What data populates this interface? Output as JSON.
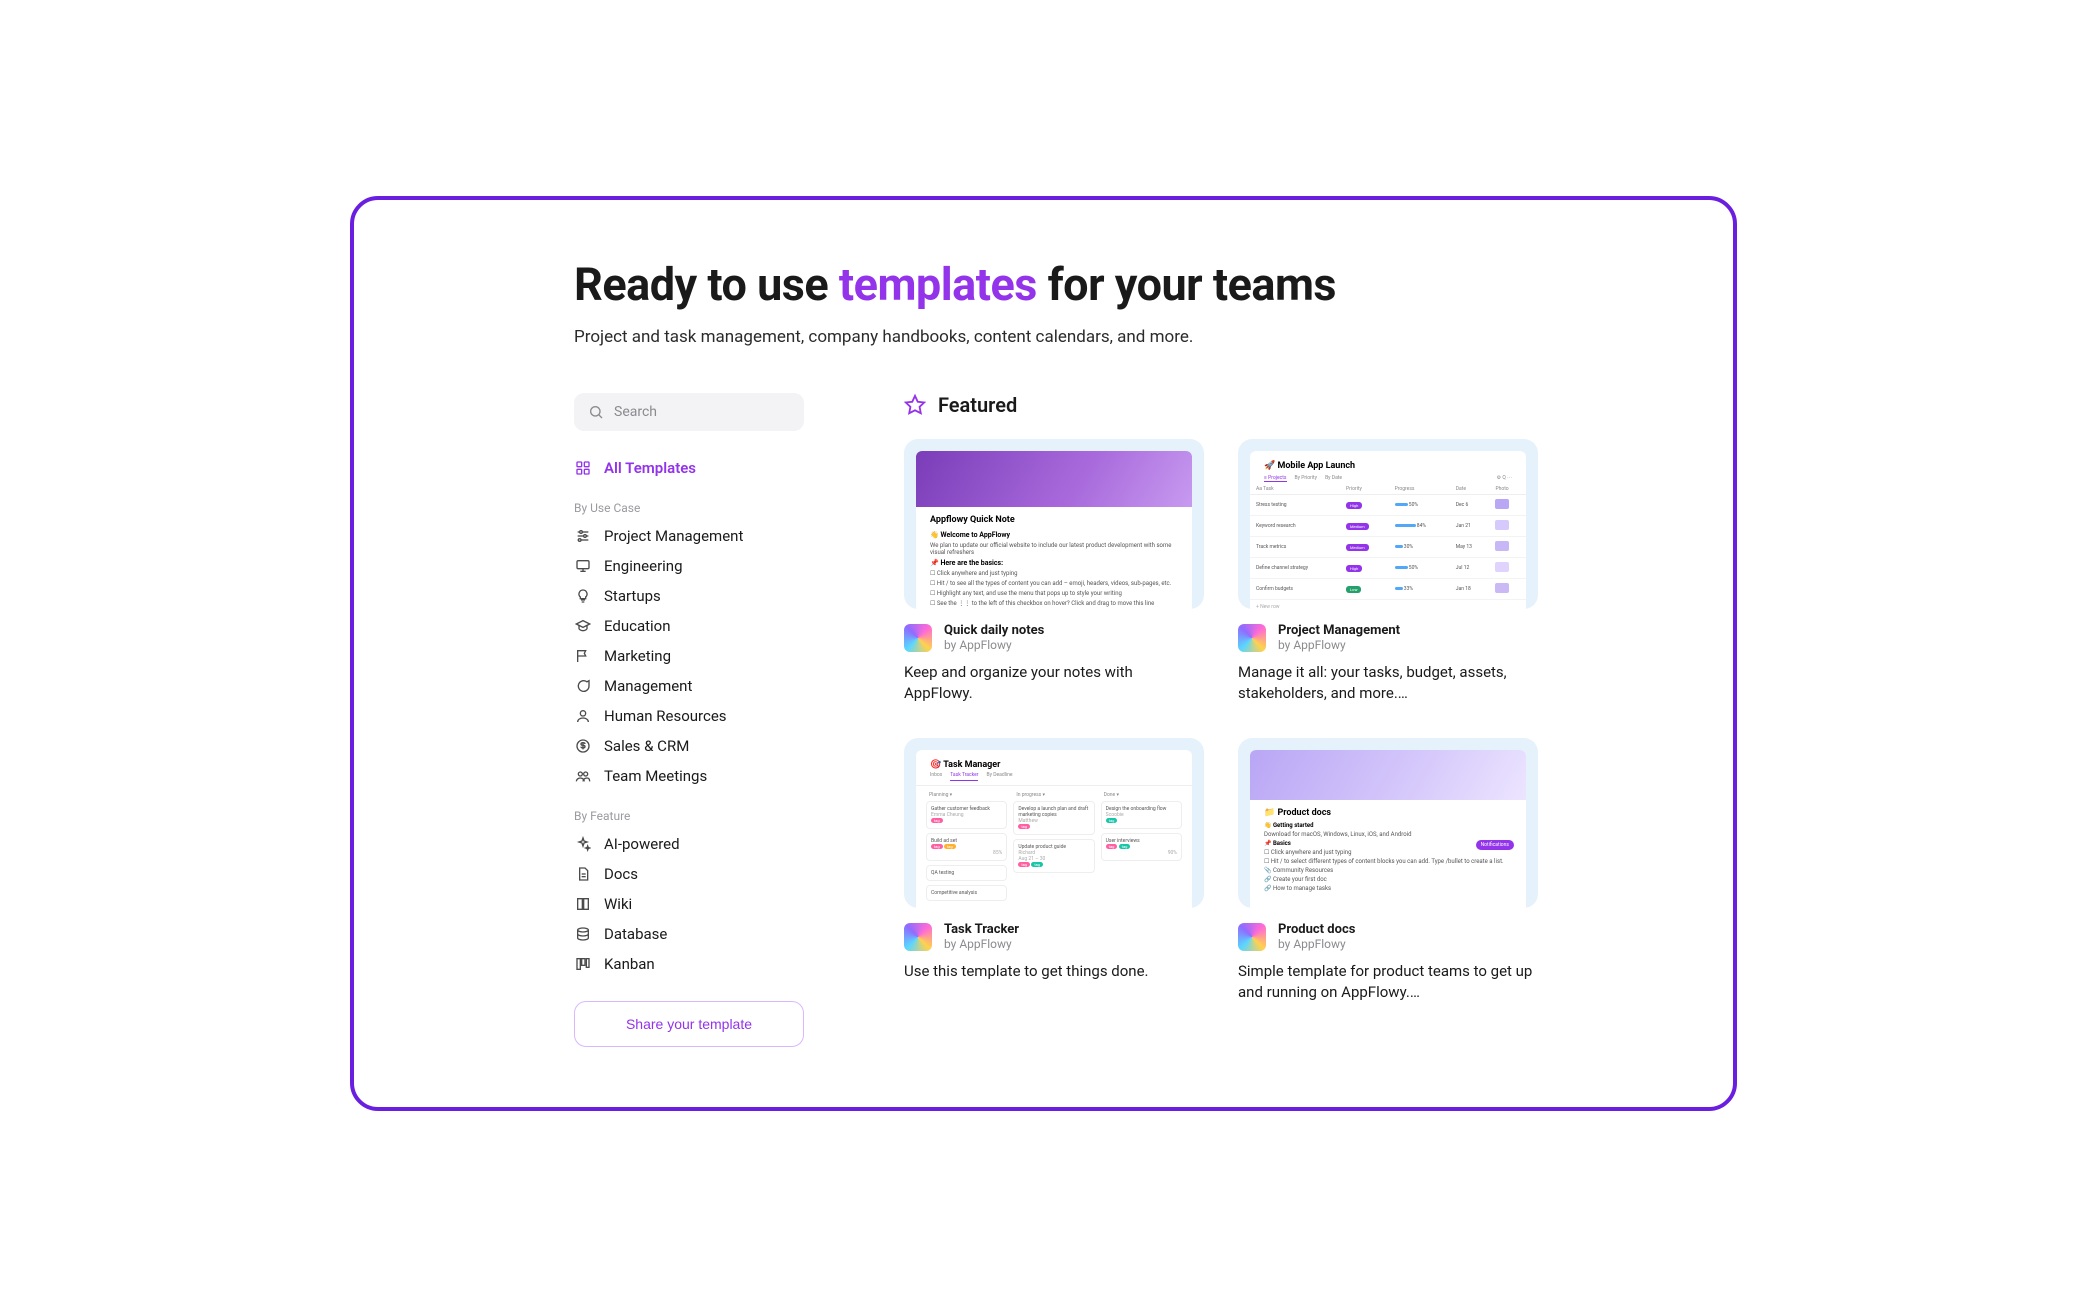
{
  "hero": {
    "title_pre": "Ready to use ",
    "title_accent": "templates",
    "title_post": " for your teams",
    "subtitle": "Project and task management, company handbooks, content calendars, and more."
  },
  "search": {
    "placeholder": "Search"
  },
  "sidebar": {
    "all_label": "All Templates",
    "section1_header": "By Use Case",
    "section1": [
      {
        "label": "Project Management",
        "icon": "sliders"
      },
      {
        "label": "Engineering",
        "icon": "monitor"
      },
      {
        "label": "Startups",
        "icon": "bulb"
      },
      {
        "label": "Education",
        "icon": "grad"
      },
      {
        "label": "Marketing",
        "icon": "flag"
      },
      {
        "label": "Management",
        "icon": "chat"
      },
      {
        "label": "Human Resources",
        "icon": "user"
      },
      {
        "label": "Sales & CRM",
        "icon": "dollar"
      },
      {
        "label": "Team Meetings",
        "icon": "team"
      }
    ],
    "section2_header": "By Feature",
    "section2": [
      {
        "label": "AI-powered",
        "icon": "sparkle"
      },
      {
        "label": "Docs",
        "icon": "doc"
      },
      {
        "label": "Wiki",
        "icon": "book"
      },
      {
        "label": "Database",
        "icon": "db"
      },
      {
        "label": "Kanban",
        "icon": "kanban"
      }
    ],
    "share_button": "Share your template"
  },
  "featured": {
    "heading": "Featured",
    "cards": [
      {
        "title": "Quick daily notes",
        "author": "by AppFlowy",
        "description": "Keep and organize your notes with AppFlowy.",
        "thumb_title": "Appflowy Quick Note",
        "thumb_lines": [
          "👋 Welcome to AppFlowy",
          "We plan to update our official website to include our latest product development with some visual refreshers",
          "📌 Here are the basics:",
          "☐ Click anywhere and just typing",
          "☐ Hit  /  to see all the types of content you can add – emoji, headers, videos, sub-pages, etc.",
          "☐ Highlight any text, and use the menu that pops up to style your writing",
          "☐ See the ⋮⋮ to the left of this checkbox on hover? Click and drag to move this line"
        ]
      },
      {
        "title": "Project Management",
        "author": "by AppFlowy",
        "description": "Manage it all: your tasks, budget, assets, stakeholders, and more.…",
        "thumb_title": "🚀 Mobile App Launch",
        "table": {
          "headers": [
            "Task",
            "Priority",
            "Progress",
            "Date",
            "Photo"
          ],
          "rows": [
            {
              "task": "Stress testing",
              "priority": "High",
              "progress": 50,
              "date": "Dec 6",
              "sw": "#b9a6f5"
            },
            {
              "task": "Keyword research",
              "priority": "Medium",
              "progress": 84,
              "date": "Jan 21",
              "sw": "#d6c9fb"
            },
            {
              "task": "Track metrics",
              "priority": "Medium",
              "progress": 30,
              "date": "May 13",
              "sw": "#c8b7f7"
            },
            {
              "task": "Define channel strategy",
              "priority": "High",
              "progress": 50,
              "date": "Jul 12",
              "sw": "#e0d4ff"
            },
            {
              "task": "Confirm budgets",
              "priority": "Low",
              "progress": 33,
              "date": "Jan 18",
              "sw": "#cab9f5"
            }
          ],
          "footer": "+ New row"
        }
      },
      {
        "title": "Task Tracker",
        "author": "by AppFlowy",
        "description": "Use this template to get things done.",
        "thumb_title": "🎯 Task Manager",
        "tabs": [
          "Inbox",
          "Task Tracker",
          "By Deadline"
        ],
        "board": {
          "cols": [
            {
              "name": "Planning",
              "cards": [
                {
                  "t": "Gather customer feedback",
                  "sub": "Emma Cheung",
                  "pills": [
                    "#ff5fa2"
                  ]
                },
                {
                  "t": "Build ad set",
                  "pills": [
                    "#ff5fa2",
                    "#ffb02e"
                  ],
                  "pct": "85%"
                },
                {
                  "t": "QA testing"
                },
                {
                  "t": "Competitive analysis"
                }
              ]
            },
            {
              "name": "In progress",
              "cards": [
                {
                  "t": "Develop a launch plan and draft marketing copies",
                  "sub": "Matthew",
                  "pills": [
                    "#ff5fa2"
                  ]
                },
                {
                  "t": "Update product guide",
                  "sub": "Richard",
                  "date": "Aug 21 – 30",
                  "pills": [
                    "#ff5fa2",
                    "#17c6a8"
                  ]
                }
              ]
            },
            {
              "name": "Done",
              "cards": [
                {
                  "t": "Design the onboarding flow",
                  "sub": "Scoobie",
                  "pills": [
                    "#17c6a8"
                  ]
                },
                {
                  "t": "User interviews",
                  "pills": [
                    "#ff5fa2",
                    "#17c6a8"
                  ],
                  "pct": "90%"
                }
              ]
            }
          ]
        }
      },
      {
        "title": "Product docs",
        "author": "by AppFlowy",
        "description": "Simple template for product teams to get up and running on AppFlowy.…",
        "thumb_title": "📁 Product docs",
        "thumb_lines": [
          "👋 Getting started",
          "Download for macOS, Windows, Linux, iOS, and Android",
          "📌 Basics",
          "☐ Click anywhere and just typing",
          "☐ Hit  /  to select different types of content blocks you can add. Type /bullet to create a list.",
          "📎 Community Resources",
          "🔗 Create your first doc",
          "🔗 How to manage tasks"
        ],
        "badge": "Notifications"
      }
    ]
  }
}
